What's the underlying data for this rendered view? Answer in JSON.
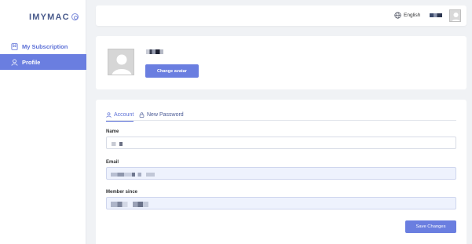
{
  "app": {
    "brand": "IMYMAC",
    "brand_icon": "settings-circle-icon"
  },
  "sidebar": {
    "items": [
      {
        "label": "My Subscription",
        "icon": "subscription-icon",
        "active": false
      },
      {
        "label": "Profile",
        "icon": "user-icon",
        "active": true
      }
    ]
  },
  "header": {
    "language": "English",
    "language_icon": "globe-icon"
  },
  "avatar_section": {
    "change_avatar_label": "Change avatar"
  },
  "tabs": [
    {
      "label": "Account",
      "icon": "user-icon",
      "active": true
    },
    {
      "label": "New Password",
      "icon": "lock-icon",
      "active": false
    }
  ],
  "form": {
    "fields": [
      {
        "label": "Name",
        "readonly": false
      },
      {
        "label": "Email",
        "readonly": true
      },
      {
        "label": "Member since",
        "readonly": true
      }
    ],
    "save_label": "Save Changes"
  },
  "colors": {
    "accent": "#6a7ee0",
    "accent_text": "#5b6fd6",
    "readonly_field_bg": "#eef2fd",
    "page_bg": "#f0f2f5"
  }
}
